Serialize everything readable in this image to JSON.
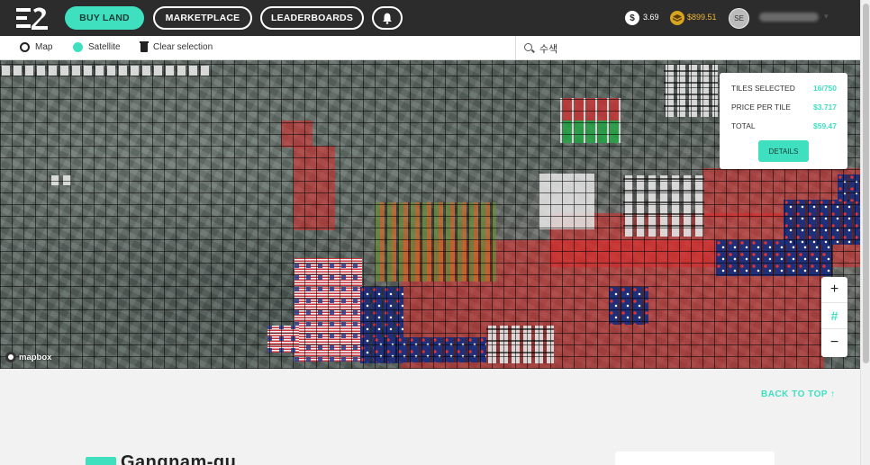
{
  "nav": {
    "buy_land": "BUY LAND",
    "marketplace": "MARKETPLACE",
    "leaderboards": "LEADERBOARDS",
    "bell_icon": "bell-icon"
  },
  "wallet": {
    "usd_symbol": "$",
    "usd_balance": "3.69",
    "essence_balance": "$899.51",
    "coin_icon": "stack-coin-icon"
  },
  "user": {
    "initials": "SE"
  },
  "toolbar": {
    "map_label": "Map",
    "satellite_label": "Satellite",
    "clear_label": "Clear selection",
    "search_value": "수색"
  },
  "selection": {
    "tiles_selected_label": "TILES SELECTED",
    "tiles_selected_value": "16/750",
    "price_label": "PRICE PER TILE",
    "price_value": "$3.717",
    "total_label": "TOTAL",
    "total_value": "$59.47",
    "details_label": "DETAILS"
  },
  "zoom": {
    "in": "+",
    "grid": "#",
    "out": "−"
  },
  "map": {
    "attribution": "mapbox"
  },
  "footer": {
    "back_to_top": "BACK TO TOP ↑",
    "page_title": "Gangnam-gu"
  },
  "colors": {
    "accent": "#3ee0c0",
    "navbar": "#2c2c2c",
    "owned_tiles": "#dc2828"
  }
}
